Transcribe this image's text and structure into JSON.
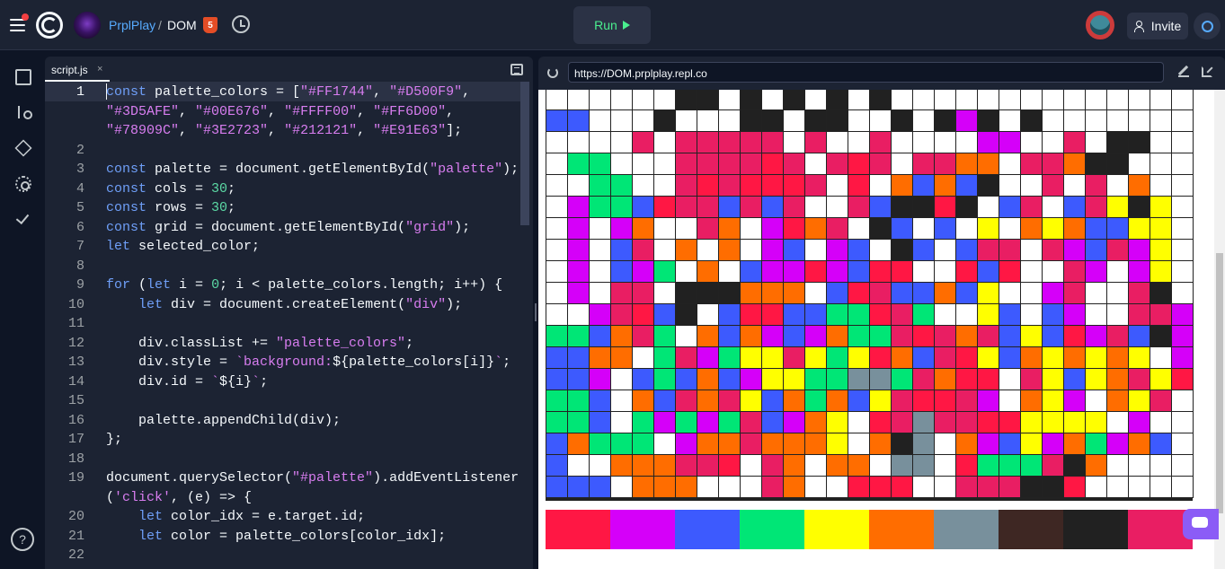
{
  "header": {
    "owner": "PrplPlay",
    "separator": "/",
    "repl_name": "DOM",
    "html_badge": "5",
    "run_label": "Run",
    "invite_label": "Invite"
  },
  "editor": {
    "tab_label": "script.js",
    "tab_close": "×",
    "lines": [
      {
        "n": "1",
        "t": [
          [
            "k",
            "const"
          ],
          [
            "p",
            " palette_colors = ["
          ],
          [
            "s",
            "\"#FF1744\""
          ],
          [
            "p",
            ", "
          ],
          [
            "s",
            "\"#D500F9\""
          ],
          [
            "p",
            ","
          ]
        ]
      },
      {
        "n": "",
        "t": [
          [
            "s",
            "\"#3D5AFE\""
          ],
          [
            "p",
            ", "
          ],
          [
            "s",
            "\"#00E676\""
          ],
          [
            "p",
            ", "
          ],
          [
            "s",
            "\"#FFFF00\""
          ],
          [
            "p",
            ", "
          ],
          [
            "s",
            "\"#FF6D00\""
          ],
          [
            "p",
            ","
          ]
        ]
      },
      {
        "n": "",
        "t": [
          [
            "s",
            "\"#78909C\""
          ],
          [
            "p",
            ", "
          ],
          [
            "s",
            "\"#3E2723\""
          ],
          [
            "p",
            ", "
          ],
          [
            "s",
            "\"#212121\""
          ],
          [
            "p",
            ", "
          ],
          [
            "s",
            "\"#E91E63\""
          ],
          [
            "p",
            "];"
          ]
        ]
      },
      {
        "n": "2",
        "t": []
      },
      {
        "n": "3",
        "t": [
          [
            "k",
            "const"
          ],
          [
            "p",
            " palette = document.getElementById("
          ],
          [
            "s",
            "\"palette\""
          ],
          [
            "p",
            ");"
          ]
        ]
      },
      {
        "n": "4",
        "t": [
          [
            "k",
            "const"
          ],
          [
            "p",
            " cols = "
          ],
          [
            "n",
            "30"
          ],
          [
            "p",
            ";"
          ]
        ]
      },
      {
        "n": "5",
        "t": [
          [
            "k",
            "const"
          ],
          [
            "p",
            " rows = "
          ],
          [
            "n",
            "30"
          ],
          [
            "p",
            ";"
          ]
        ]
      },
      {
        "n": "6",
        "t": [
          [
            "k",
            "const"
          ],
          [
            "p",
            " grid = document.getElementById("
          ],
          [
            "s",
            "\"grid\""
          ],
          [
            "p",
            ");"
          ]
        ]
      },
      {
        "n": "7",
        "t": [
          [
            "k",
            "let"
          ],
          [
            "p",
            " selected_color;"
          ]
        ]
      },
      {
        "n": "8",
        "t": []
      },
      {
        "n": "9",
        "t": [
          [
            "k",
            "for"
          ],
          [
            "p",
            " ("
          ],
          [
            "k",
            "let"
          ],
          [
            "p",
            " i = "
          ],
          [
            "n",
            "0"
          ],
          [
            "p",
            "; i < palette_colors.length; i++) {"
          ]
        ]
      },
      {
        "n": "10",
        "t": [
          [
            "p",
            "    "
          ],
          [
            "k",
            "let"
          ],
          [
            "p",
            " div = document.createElement("
          ],
          [
            "s",
            "\"div\""
          ],
          [
            "p",
            ");"
          ]
        ]
      },
      {
        "n": "11",
        "t": []
      },
      {
        "n": "12",
        "t": [
          [
            "p",
            "    div.classList += "
          ],
          [
            "s",
            "\"palette_colors\""
          ],
          [
            "p",
            ";"
          ]
        ]
      },
      {
        "n": "13",
        "t": [
          [
            "p",
            "    div.style = "
          ],
          [
            "s",
            "`background:"
          ],
          [
            "p",
            "${palette_colors[i]}"
          ],
          [
            "s",
            "`"
          ],
          [
            "p",
            ";"
          ]
        ]
      },
      {
        "n": "14",
        "t": [
          [
            "p",
            "    div.id = "
          ],
          [
            "s",
            "`"
          ],
          [
            "p",
            "${i}"
          ],
          [
            "s",
            "`"
          ],
          [
            "p",
            ";"
          ]
        ]
      },
      {
        "n": "15",
        "t": []
      },
      {
        "n": "16",
        "t": [
          [
            "p",
            "    palette.appendChild(div);"
          ]
        ]
      },
      {
        "n": "17",
        "t": [
          [
            "p",
            "};"
          ]
        ]
      },
      {
        "n": "18",
        "t": []
      },
      {
        "n": "19",
        "t": [
          [
            "p",
            "document.querySelector("
          ],
          [
            "s",
            "\"#palette\""
          ],
          [
            "p",
            ").addEventListener"
          ]
        ]
      },
      {
        "n": "",
        "t": [
          [
            "p",
            "("
          ],
          [
            "s",
            "'click'"
          ],
          [
            "p",
            ", (e) => {"
          ]
        ]
      },
      {
        "n": "20",
        "t": [
          [
            "p",
            "    "
          ],
          [
            "k",
            "let"
          ],
          [
            "p",
            " color_idx = e.target.id;"
          ]
        ]
      },
      {
        "n": "21",
        "t": [
          [
            "p",
            "    "
          ],
          [
            "k",
            "let"
          ],
          [
            "p",
            " color = palette_colors[color_idx];"
          ]
        ]
      },
      {
        "n": "22",
        "t": []
      }
    ]
  },
  "webview": {
    "url": "https://DOM.prplplay.repl.co"
  },
  "help_label": "?",
  "palette_colors": [
    "#FF1744",
    "#D500F9",
    "#3D5AFE",
    "#00E676",
    "#FFFF00",
    "#FF6D00",
    "#78909C",
    "#3E2723",
    "#212121",
    "#E91E63"
  ],
  "grid_rows": [
    "WWWWWWKKWKWKWKWKWWWWWWWWWWWWWW",
    "BBWWWKWWWKKWKKWWKWKPKWKWWWWWWW",
    "WWWWMWMMMMMWMWWMWWWWPPWWMWKKWW",
    "WGGWWWMMMMRMWMRMWMMOOWMMOKKWWW",
    "WWGGWWMRMRRRMWRWOBOBKWWMWMWOWW",
    "WPGGBRMMBMBMWWMBKKRKWBMWBMYKYW",
    "WPWPOWWMOWPROMWKBWBWYWOYOBBYYW",
    "WPWBMWOWOWPBWPBWKBWBMMWMPBMPYW",
    "WPWBPGWOWBPPRPBRRWWRBRWWMPWPYW",
    "WPWMMWKKKOOOWBRMBBOBYWWPMWWMKW",
    "WWPMRBKWBRRBBGGRMGWWYBWBPWWMMP",
    "GGBOMGWOBOPBPOGGMRMOMBYBRPMBKP",
    "BBOOWGMPGYYMYGYROBMRYBOYOYOYWP",
    "BBPWBGBOBPYYGGSSGMORRWMYBYOMYR",
    "GGBWOBMOMYBOGOBYMRRMPWOYPWOYMW",
    "GGBWGPGPGMBPOYWRMSMMRRYYYYWPWW",
    "BOGGGWPOOMOOOYWOKSWOPBYPOGPOBW",
    "BWWOOOMMRWMOWOOWSSWRGGGMKOWWWW",
    "BBBWOOOWWWMOWWRRRWWMMMKKRWWWWW"
  ],
  "grid_key": {
    "W": "#FFFFFF",
    "K": "#212121",
    "D": "#3E2723",
    "R": "#FF1744",
    "P": "#D500F9",
    "B": "#3D5AFE",
    "G": "#00E676",
    "Y": "#FFFF00",
    "O": "#FF6D00",
    "S": "#78909C",
    "M": "#E91E63"
  }
}
